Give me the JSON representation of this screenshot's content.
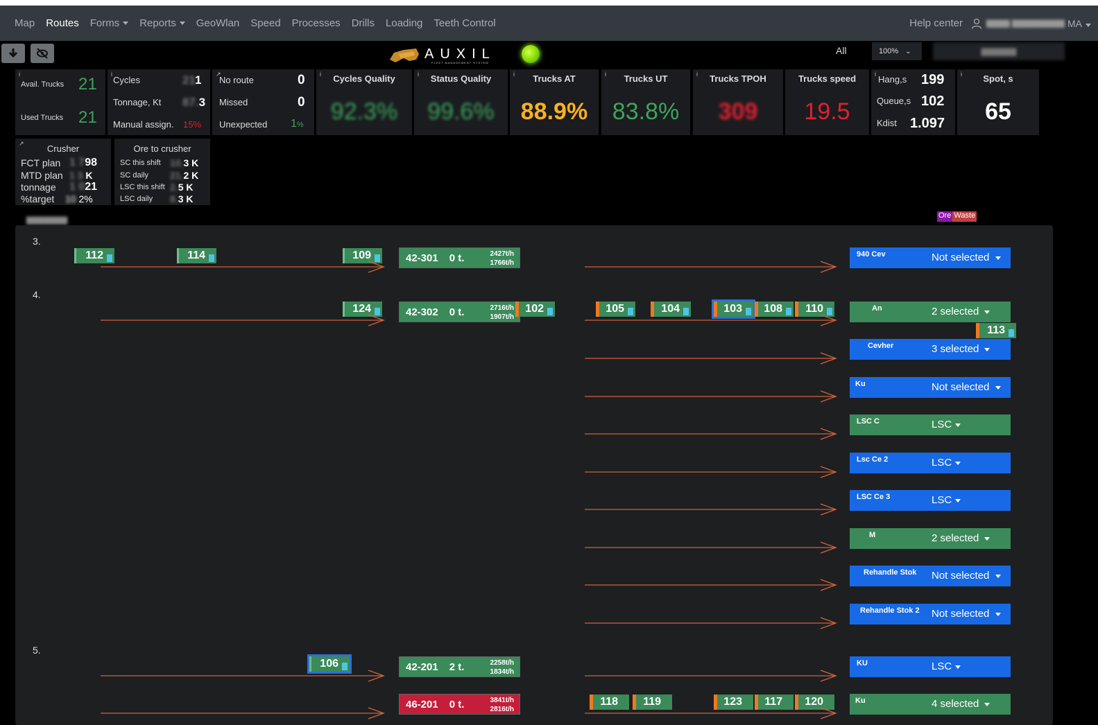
{
  "nav": {
    "items": [
      "Map",
      "Routes",
      "Forms",
      "Reports",
      "GeoWlan",
      "Speed",
      "Processes",
      "Drills",
      "Loading",
      "Teeth Control"
    ],
    "help": "Help center",
    "user_initials": "MA"
  },
  "toolbar": {
    "logo_text": "AUXIL",
    "logo_sub": "FLEET MANAGEMENT SYSTEM",
    "filter_all": "All",
    "zoom": "100%"
  },
  "kpi": {
    "avail_trucks_label": "Avail. Trucks",
    "avail_trucks": "21",
    "used_trucks_label": "Used Trucks",
    "used_trucks": "21",
    "cycles_label": "Cycles",
    "cycles_suffix": "1",
    "tonnage_label": "Tonnage, Kt",
    "tonnage_suffix": "3",
    "manual_label": "Manual assign.",
    "manual": "15%",
    "noroute_label": "No route",
    "noroute": "0",
    "missed_label": "Missed",
    "missed": "0",
    "unexpected_label": "Unexpected",
    "unexpected": "1",
    "unexpected_unit": "%",
    "cycles_quality_label": "Cycles Quality",
    "cycles_quality": "92.3%",
    "status_quality_label": "Status Quality",
    "status_quality": "99.6%",
    "trucks_at_label": "Trucks AT",
    "trucks_at": "88.9%",
    "trucks_ut_label": "Trucks UT",
    "trucks_ut": "83.8%",
    "trucks_tpoh_label": "Trucks TPOH",
    "trucks_tpoh": "309",
    "trucks_speed_label": "Trucks speed",
    "trucks_speed": "19.5",
    "hang_label": "Hang,s",
    "hang": "199",
    "queue_label": "Queue,s",
    "queue": "102",
    "kdist_label": "Kdist",
    "kdist": "1.097",
    "spot_label": "Spot, s",
    "spot": "65"
  },
  "crusher": {
    "title": "Crusher",
    "rows": [
      {
        "label": "FCT plan",
        "value": "98"
      },
      {
        "label": "MTD plan",
        "value": "K"
      },
      {
        "label": "tonnage",
        "value": "21"
      },
      {
        "label": "%target",
        "value": "2%"
      }
    ]
  },
  "ore": {
    "title": "Ore to crusher",
    "rows": [
      {
        "label": "SC this shift",
        "value": "3 K"
      },
      {
        "label": "SC daily",
        "value": "2 K"
      },
      {
        "label": "LSC this shift",
        "value": "5 K"
      },
      {
        "label": "LSC daily",
        "value": "3 K"
      }
    ]
  },
  "legend": {
    "ore": "Ore",
    "waste": "Waste"
  },
  "routes": {
    "groups": [
      "3.",
      "4.",
      "5."
    ],
    "trucks": [
      "112",
      "114",
      "109",
      "124",
      "102",
      "105",
      "104",
      "103",
      "108",
      "110",
      "113",
      "106",
      "118",
      "119",
      "123",
      "117",
      "120"
    ],
    "shovels": [
      {
        "name": "42-301",
        "t": "0 t.",
        "r1": "2427t/h",
        "r2": "1766t/h"
      },
      {
        "name": "42-302",
        "t": "0 t.",
        "r1": "2716t/h",
        "r2": "1907t/h"
      },
      {
        "name": "42-201",
        "t": "2 t.",
        "r1": "2258t/h",
        "r2": "1834t/h"
      },
      {
        "name": "46-201",
        "t": "0 t.",
        "r1": "3841t/h",
        "r2": "2816t/h"
      }
    ],
    "dests": [
      {
        "name": "940 Cev",
        "value": "Not selected"
      },
      {
        "name": "An",
        "value": "2 selected"
      },
      {
        "name": "Cevher",
        "value": "3 selected"
      },
      {
        "name": "Ku",
        "value": "Not selected"
      },
      {
        "name": "LSC C",
        "value": "LSC"
      },
      {
        "name": "Lsc Ce 2",
        "value": "LSC"
      },
      {
        "name": "LSC Ce 3",
        "value": "LSC"
      },
      {
        "name": "M",
        "value": "2 selected"
      },
      {
        "name": "Rehandle Stok",
        "value": "Not selected"
      },
      {
        "name": "Rehandle Stok 2",
        "value": "Not selected"
      },
      {
        "name": "KU",
        "value": "LSC"
      },
      {
        "name": "Ku",
        "value": "4 selected"
      }
    ]
  },
  "colors": {
    "green": "#3ea35d",
    "red": "#e02030",
    "orange": "#ffb020",
    "blue": "#1769e6"
  }
}
